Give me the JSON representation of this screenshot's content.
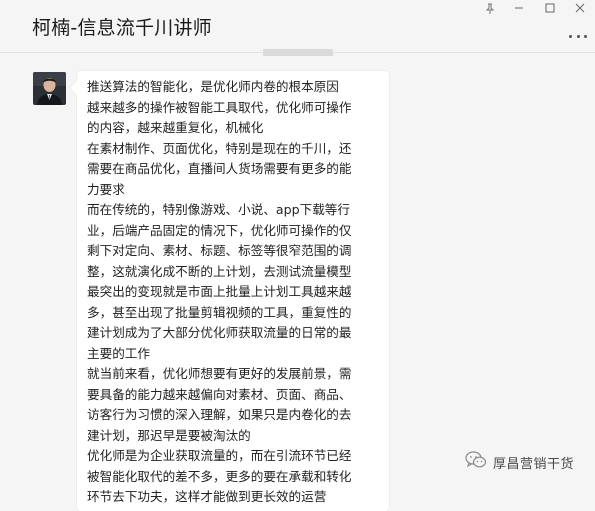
{
  "window": {
    "title": "柯楠-信息流千川讲师",
    "controls": [
      "pin-icon",
      "minimize-icon",
      "maximize-icon",
      "close-icon"
    ],
    "more_icon": "more-icon"
  },
  "conversation": {
    "sender_avatar": "avatar",
    "message_lines": [
      "推送算法的智能化，是优化师内卷的根本原因",
      "越来越多的操作被智能工具取代，优化师可操作",
      "的内容，越来越重复化，机械化",
      "在素材制作、页面优化，特别是现在的千川，还",
      "需要在商品优化，直播间人货场需要有更多的能",
      "力要求",
      "而在传统的，特别像游戏、小说、app下载等行",
      "业，后端产品固定的情况下，优化师可操作的仅",
      "剩下对定向、素材、标题、标签等很窄范围的调",
      "整，这就演化成不断的上计划，去测试流量模型",
      "最突出的变现就是市面上批量上计划工具越来越",
      "多，甚至出现了批量剪辑视频的工具，重复性的",
      "建计划成为了大部分优化师获取流量的日常的最",
      "主要的工作",
      "就当前来看，优化师想要有更好的发展前景，需",
      "要具备的能力越来越偏向对素材、页面、商品、",
      "访客行为习惯的深入理解，如果只是内卷化的去",
      "建计划，那迟早是要被淘汰的",
      "优化师是为企业获取流量的，而在引流环节已经",
      "被智能化取代的差不多，更多的要在承载和转化",
      "环节去下功夫，这样才能做到更长效的运营"
    ]
  },
  "watermark": {
    "icon": "wechat-icon",
    "text": "厚昌营销干货"
  },
  "colors": {
    "background": "#f5f5f5",
    "bubble": "#ffffff",
    "text": "#222222"
  }
}
